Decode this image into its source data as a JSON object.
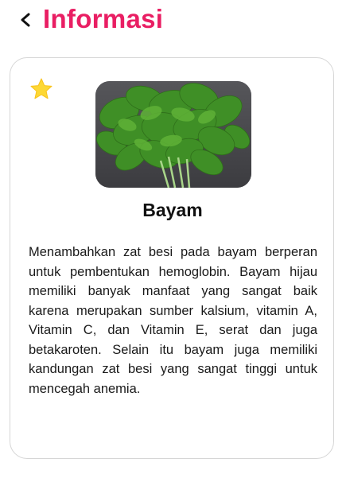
{
  "header": {
    "back_icon": "chevron-left-icon",
    "title": "Informasi"
  },
  "card": {
    "favorite_icon": "star-icon",
    "favorite_color": "#fdd835",
    "image_subject": "spinach-photo",
    "name": "Bayam",
    "description": "Menambahkan zat besi pada bayam berperan untuk pembentukan hemoglobin. Bayam hijau memiliki banyak manfaat yang sangat baik karena merupakan sumber kalsium, vitamin A, Vitamin C, dan Vitamin E, serat dan juga betakaroten. Selain itu bayam juga memiliki kandungan zat besi yang sangat tinggi untuk mencegah anemia."
  },
  "colors": {
    "accent": "#e91e63",
    "card_border": "#d6d6d6"
  }
}
